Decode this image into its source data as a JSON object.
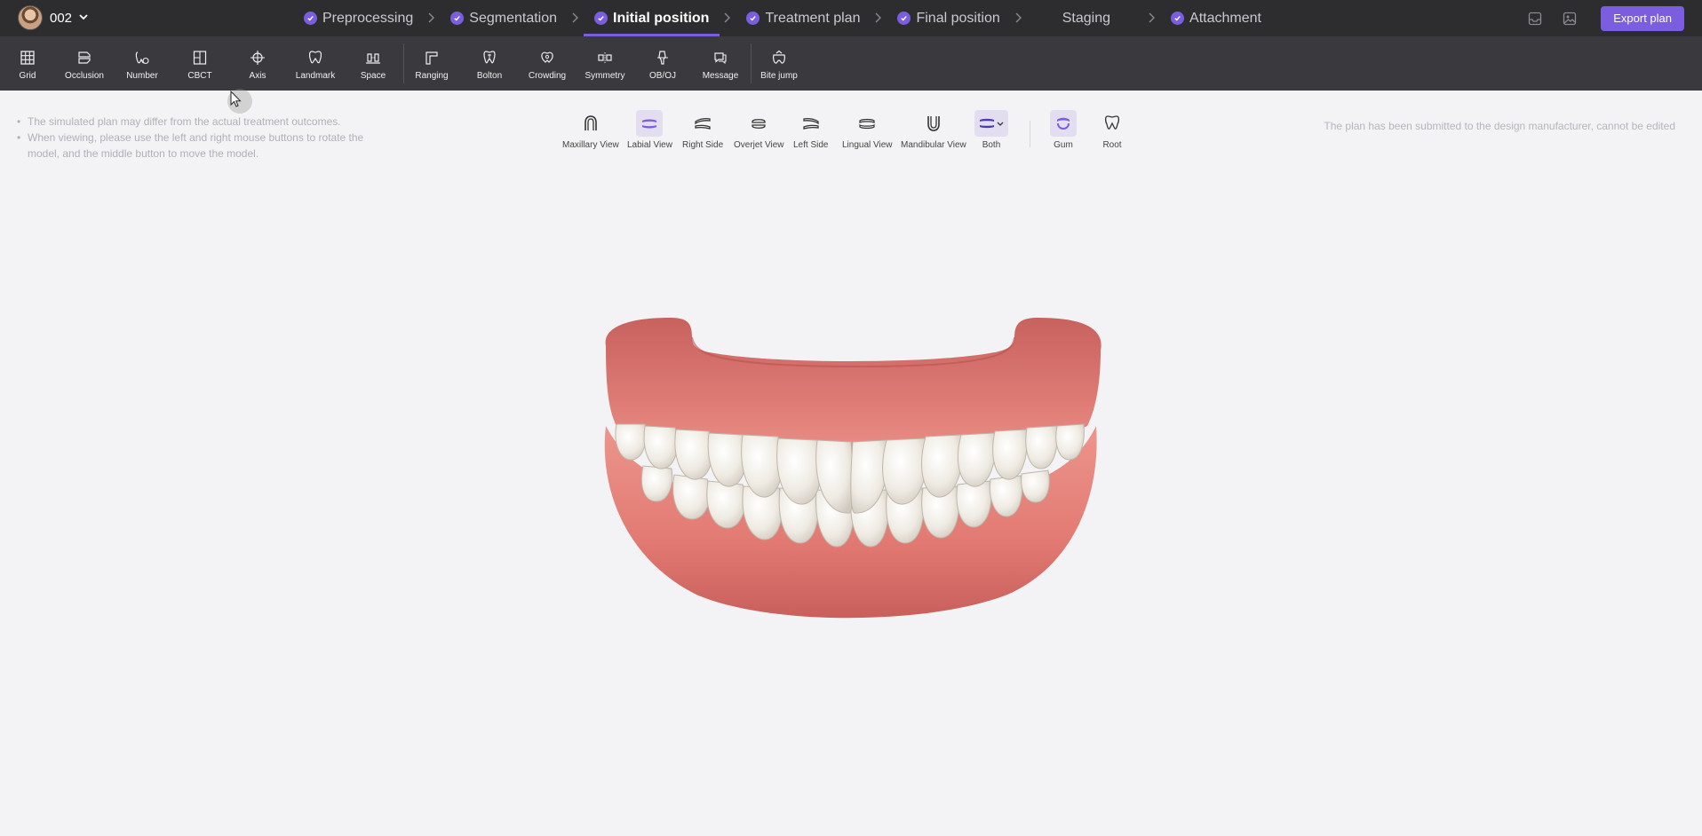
{
  "patient": {
    "name": "002"
  },
  "steps": [
    {
      "label": "Preprocessing",
      "done": true,
      "active": false
    },
    {
      "label": "Segmentation",
      "done": true,
      "active": false
    },
    {
      "label": "Initial position",
      "done": true,
      "active": true
    },
    {
      "label": "Treatment plan",
      "done": true,
      "active": false
    },
    {
      "label": "Final position",
      "done": true,
      "active": false
    },
    {
      "label": "Staging",
      "done": false,
      "active": false
    },
    {
      "label": "Attachment",
      "done": true,
      "active": false
    }
  ],
  "header": {
    "export_label": "Export plan"
  },
  "tools": [
    "Grid",
    "Occlusion",
    "Number",
    "CBCT",
    "Axis",
    "Landmark",
    "Space",
    "Ranging",
    "Bolton",
    "Crowding",
    "Symmetry",
    "OB/OJ",
    "Message",
    "Bite jump"
  ],
  "tips": [
    "The simulated plan may differ from the actual treatment outcomes.",
    "When viewing, please use the left and right mouse buttons to rotate the model, and the middle button to move the model."
  ],
  "views": [
    {
      "label": "Maxillary View",
      "selected": false
    },
    {
      "label": "Labial View",
      "selected": true
    },
    {
      "label": "Right Side",
      "selected": false
    },
    {
      "label": "Overjet View",
      "selected": false
    },
    {
      "label": "Left Side",
      "selected": false
    },
    {
      "label": "Lingual View",
      "selected": false
    },
    {
      "label": "Mandibular View",
      "selected": false
    },
    {
      "label": "Both",
      "selected": true
    },
    {
      "label": "Gum",
      "selected": true
    },
    {
      "label": "Root",
      "selected": false
    }
  ],
  "notice": "The plan has been submitted to the design manufacturer, cannot be edited",
  "colors": {
    "accent": "#7b5ee0",
    "topbar": "#2d2d30",
    "toolbar": "#3a3a3e",
    "gum": "#e27a74",
    "tooth": "#f2eee6"
  }
}
